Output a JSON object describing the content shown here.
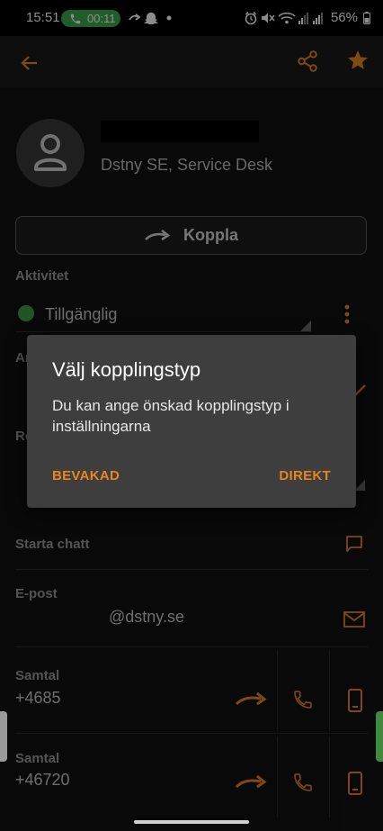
{
  "status_bar": {
    "time": "15:51",
    "call_timer": "00:11",
    "battery": "56%"
  },
  "contact": {
    "organization": "Dstny SE, Service Desk"
  },
  "actions": {
    "koppla_label": "Koppla",
    "chat_label": "Starta chatt"
  },
  "activity": {
    "label": "Aktivitet",
    "value": "Tillgänglig",
    "status_color": "#3e9a48"
  },
  "hidden_labels": {
    "a": "Ar",
    "b": "Ro"
  },
  "email": {
    "label": "E-post",
    "value": "@dstny.se"
  },
  "calls": [
    {
      "label": "Samtal",
      "number": "+4685"
    },
    {
      "label": "Samtal",
      "number": "+46720"
    }
  ],
  "dialog": {
    "title": "Välj kopplingstyp",
    "message": "Du kan ange önskad kopplingstyp i inställningarna",
    "btn_left": "BEVAKAD",
    "btn_right": "DIREKT"
  },
  "colors": {
    "accent": "#e8851f",
    "dialog_bg": "#3e3e3e"
  }
}
